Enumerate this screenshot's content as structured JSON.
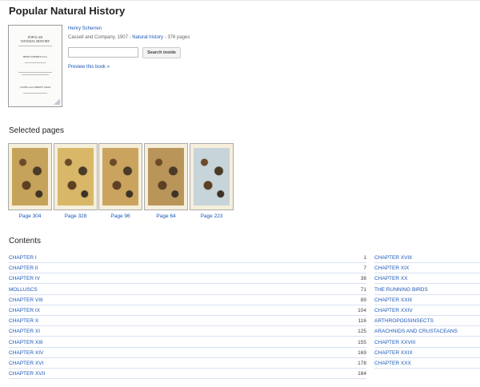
{
  "book": {
    "title": "Popular Natural History",
    "author": "Henry Scherren",
    "publisher_year": "Cassell and Company, 1907",
    "sep1": " - ",
    "subject": "Natural history",
    "sep2": " - ",
    "pages": "376 pages",
    "preview_link": "Preview this book »"
  },
  "cover": {
    "line1": "POPULAR",
    "line2": "NATURAL HISTORY",
    "line3": "HENRY SCHERREN, F.Z.S.",
    "line4": "CASSELL and COMPANY, Limited"
  },
  "search": {
    "placeholder": "",
    "button_label": "Search inside"
  },
  "selected_pages": {
    "title": "Selected pages",
    "items": [
      {
        "label": "Page 304",
        "color": "#c6a35a"
      },
      {
        "label": "Page 328",
        "color": "#d8b868"
      },
      {
        "label": "Page 96",
        "color": "#caa45e"
      },
      {
        "label": "Page 64",
        "color": "#b9955a"
      },
      {
        "label": "Page 223",
        "color": "#c7d4d9"
      }
    ]
  },
  "contents": {
    "title": "Contents",
    "left": [
      {
        "chapter": "CHAPTER I",
        "page": "1"
      },
      {
        "chapter": "CHAPTER II",
        "page": "7"
      },
      {
        "chapter": "CHAPTER IV",
        "page": "38"
      },
      {
        "chapter": "MOLLUSCS",
        "page": "71"
      },
      {
        "chapter": "CHAPTER VIII",
        "page": "89"
      },
      {
        "chapter": "CHAPTER IX",
        "page": "104"
      },
      {
        "chapter": "CHAPTER X",
        "page": "116"
      },
      {
        "chapter": "CHAPTER XI",
        "page": "125"
      },
      {
        "chapter": "CHAPTER XIII",
        "page": "155"
      },
      {
        "chapter": "CHAPTER XIV",
        "page": "169"
      },
      {
        "chapter": "CHAPTER XVI",
        "page": "178"
      },
      {
        "chapter": "CHAPTER XVII",
        "page": "184"
      }
    ],
    "right": [
      {
        "chapter": "CHAPTER XVIII"
      },
      {
        "chapter": "CHAPTER XIX"
      },
      {
        "chapter": "CHAPTER XX"
      },
      {
        "chapter": "THE RUNNING BIRDS"
      },
      {
        "chapter": "CHAPTER XXIII"
      },
      {
        "chapter": "CHAPTER XXIV"
      },
      {
        "chapter": "ARTHROPODSINSECTS"
      },
      {
        "chapter": "ARACHNIDS AND CRUSTACEANS"
      },
      {
        "chapter": "CHAPTER XXVIII"
      },
      {
        "chapter": "CHAPTER XXIX"
      },
      {
        "chapter": "CHAPTER XXX"
      }
    ]
  }
}
